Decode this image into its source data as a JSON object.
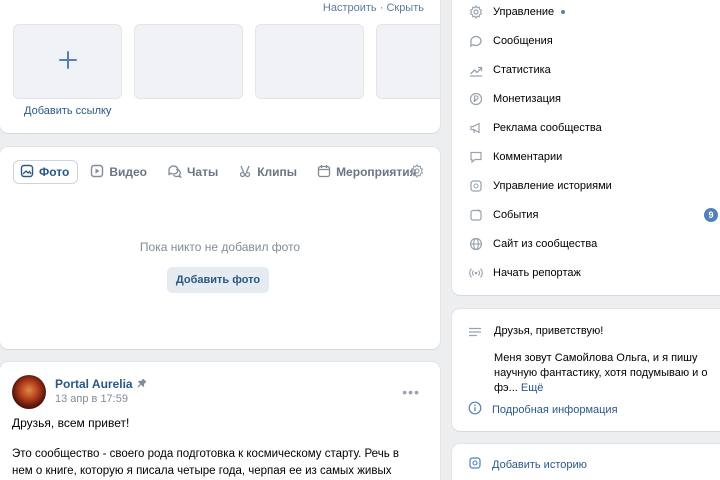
{
  "links": {
    "configure_label": "Настроить",
    "separator": " · ",
    "hide_label": "Скрыть",
    "add_link_label": "Добавить ссылку"
  },
  "media": {
    "tabs": [
      {
        "label": "Фото",
        "icon": "photo-icon",
        "active": true
      },
      {
        "label": "Видео",
        "icon": "video-icon"
      },
      {
        "label": "Чаты",
        "icon": "chats-icon"
      },
      {
        "label": "Клипы",
        "icon": "clips-icon"
      },
      {
        "label": "Мероприятия",
        "icon": "events-icon"
      }
    ],
    "empty_text": "Пока никто не добавил фото",
    "add_photo_label": "Добавить фото"
  },
  "post": {
    "author": "Portal Aurelia",
    "date": "13 апр в 17:59",
    "more": "•••",
    "greeting": "Друзья, всем привет!",
    "body": "Это сообщество - своего рода подготовка к космическому старту. Речь в нем о книге, которую я писала четыре года, черпая ее из самых живых ощущений,"
  },
  "menu": {
    "items": [
      {
        "label": "Управление",
        "icon": "gear-icon"
      },
      {
        "label": "Сообщения",
        "icon": "message-icon"
      },
      {
        "label": "Статистика",
        "icon": "statistics-icon"
      },
      {
        "label": "Монетизация",
        "icon": "monetization-icon"
      },
      {
        "label": "Реклама сообщества",
        "icon": "ads-icon"
      },
      {
        "label": "Комментарии",
        "icon": "comment-icon"
      },
      {
        "label": "Управление историями",
        "icon": "stories-icon"
      },
      {
        "label": "События",
        "icon": "events-icon",
        "badge": "9"
      },
      {
        "label": "Сайт из сообщества",
        "icon": "globe-icon"
      },
      {
        "label": "Начать репортаж",
        "icon": "broadcast-icon"
      }
    ],
    "accent": "#5181b8"
  },
  "about": {
    "greeting": "Друзья, приветствую!",
    "text": "Меня зовут Самойлова Ольга, и я пишу научную фантастику, хотя подумываю и о фэ...",
    "more_label": "Ещё",
    "info_label": "Подробная информация"
  },
  "stories": {
    "add_label": "Добавить историю"
  }
}
